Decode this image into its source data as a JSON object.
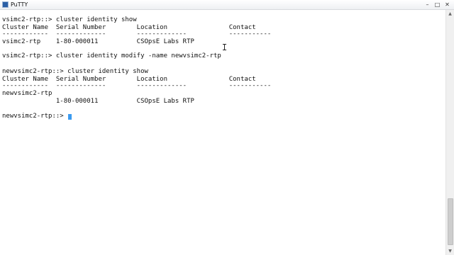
{
  "window": {
    "title": "PuTTY",
    "controls": {
      "minimize": "–",
      "maximize": "□",
      "close": "✕"
    }
  },
  "terminal": {
    "lines": [
      "vsimc2-rtp::> cluster identity show",
      "Cluster Name  Serial Number        Location                Contact",
      "------------  -------------        -------------           -----------",
      "vsimc2-rtp    1-80-000011          CSOpsE Labs RTP",
      "vsimc2-rtp::> cluster identity modify -name newvsimc2-rtp",
      "newvsimc2-rtp::> cluster identity show",
      "Cluster Name  Serial Number        Location                Contact",
      "------------  -------------        -------------           -----------",
      "newvsimc2-rtp",
      "              1-80-000011          CSOpsE Labs RTP",
      "newvsimc2-rtp::> "
    ]
  },
  "scrollbar": {
    "up_arrow": "▲",
    "down_arrow": "▼"
  }
}
